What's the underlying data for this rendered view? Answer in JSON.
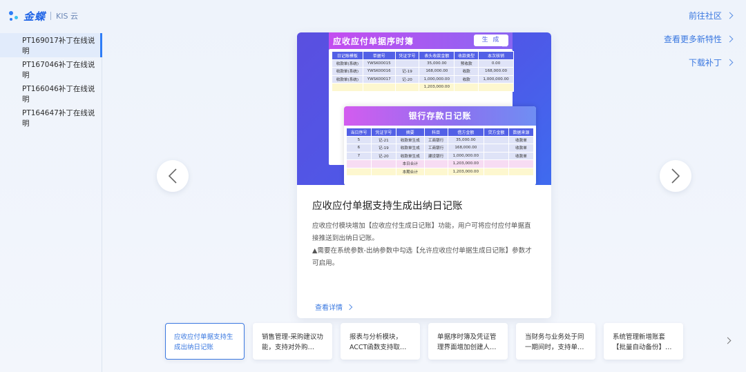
{
  "header": {
    "brand": "金蝶",
    "product": "KIS 云"
  },
  "sidebar": {
    "items": [
      {
        "label": "PT169017补丁在线说明"
      },
      {
        "label": "PT167046补丁在线说明"
      },
      {
        "label": "PT166046补丁在线说明"
      },
      {
        "label": "PT164647补丁在线说明"
      }
    ],
    "active_index": 0
  },
  "right_links": [
    {
      "label": "前往社区"
    },
    {
      "label": "查看更多新特性"
    },
    {
      "label": "下载补丁"
    }
  ],
  "card": {
    "image": {
      "panel1_title": "应收应付单据序时簿",
      "generate_button": "生 成",
      "table1": {
        "headers": [
          "日记账模板",
          "单据号",
          "凭证字号",
          "表头收款金额",
          "收款类型",
          "本次核销"
        ],
        "rows": [
          [
            "收款单(系统)",
            "YWSK00015",
            "",
            "35,000.00",
            "预收款",
            "0.00"
          ],
          [
            "收款单(系统)",
            "YWSK00016",
            "记-19",
            "168,000.00",
            "收款",
            "168,000.00"
          ],
          [
            "收款单(系统)",
            "YWSK00017",
            "记-20",
            "1,000,000.00",
            "收款",
            "1,000,000.00"
          ]
        ],
        "total": [
          "",
          "",
          "",
          "1,203,000.00",
          "",
          ""
        ]
      },
      "panel2_title": "银行存款日记账",
      "table2": {
        "headers": [
          "当日序号",
          "凭证字号",
          "摘要",
          "科目",
          "借方金额",
          "贷方金额",
          "数据来源"
        ],
        "rows": [
          [
            "5",
            "记-21",
            "收款单生成",
            "工商银行",
            "35,000.00",
            "",
            "收款单"
          ],
          [
            "6",
            "记-19",
            "收款单生成",
            "工商银行",
            "168,000.00",
            "",
            "收款单"
          ],
          [
            "7",
            "记-20",
            "收款单生成",
            "建设银行",
            "1,000,000.00",
            "",
            "收款单"
          ]
        ],
        "day_total": [
          "",
          "",
          "本日合计",
          "",
          "1,203,000.00",
          "",
          ""
        ],
        "period_total": [
          "",
          "",
          "本期合计",
          "",
          "1,203,000.00",
          "",
          ""
        ]
      }
    },
    "title": "应收应付单据支持生成出纳日记账",
    "desc_line1": "应收应付模块增加【应收应付生成日记账】功能，用户可将应付应付单据直接推送到出纳日记账。",
    "desc_line2": "▲需要在系统参数-出纳参数中勾选【允许应收应付单据生成日记账】参数才可启用。",
    "more_label": "查看详情"
  },
  "thumbnails": [
    {
      "label": "应收应付单据支持生成出纳日记账",
      "active": true
    },
    {
      "label": "销售管理-采购建议功能，支持对外购…"
    },
    {
      "label": "报表与分析模块，ACCT函数支持取…"
    },
    {
      "label": "单据序时簿及凭证管理界面增加创建人…"
    },
    {
      "label": "当财务与业务处于同一期间时，支持单…"
    },
    {
      "label": "系统管理新增账套【批量自动备份】…"
    }
  ]
}
